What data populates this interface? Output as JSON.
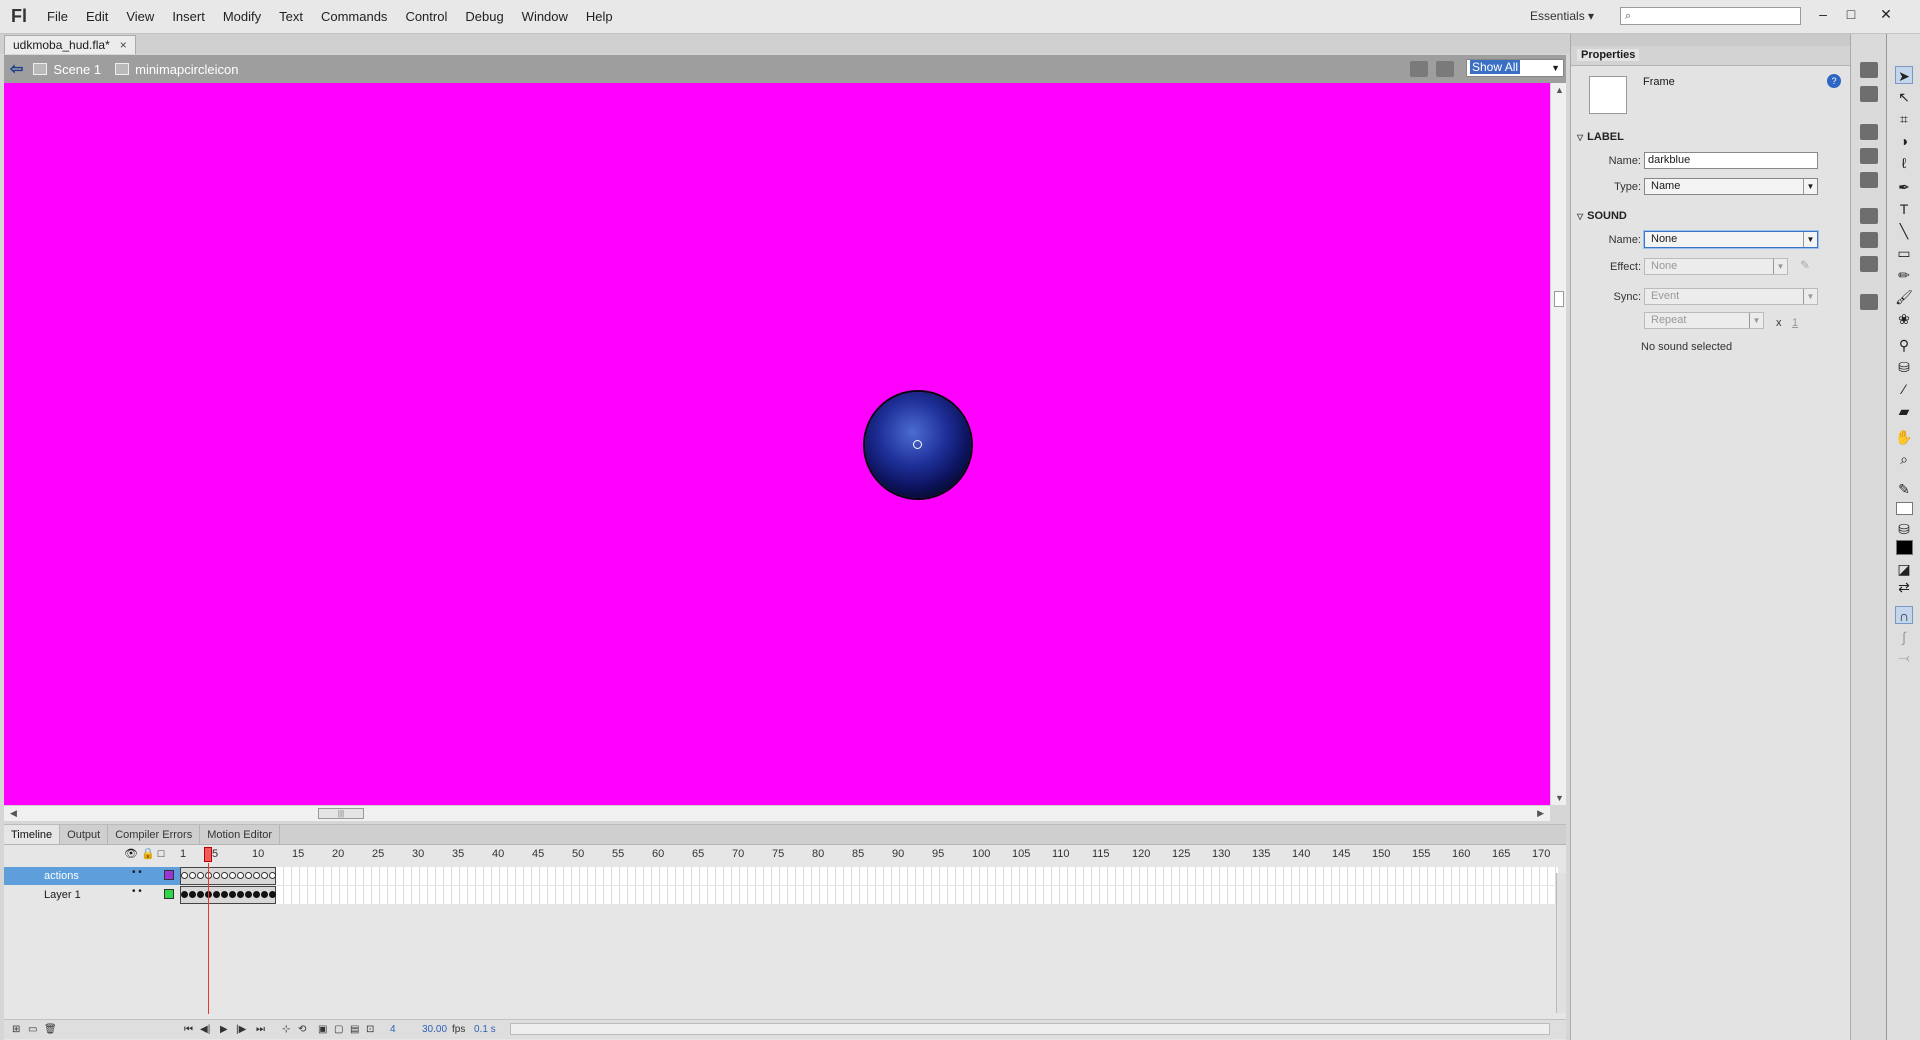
{
  "app": {
    "logo": "Fl",
    "menu": [
      "File",
      "Edit",
      "View",
      "Insert",
      "Modify",
      "Text",
      "Commands",
      "Control",
      "Debug",
      "Window",
      "Help"
    ],
    "workspace": "Essentials",
    "search_placeholder": "",
    "window_controls": [
      "–",
      "□",
      "✕"
    ]
  },
  "document": {
    "tab_title": "udkmoba_hud.fla*",
    "tab_close": "×",
    "breadcrumb": [
      "Scene 1",
      "minimapcircleicon"
    ],
    "zoom": "Show All"
  },
  "stage": {
    "background": "#ff00ff",
    "object": "dark blue circle icon"
  },
  "timeline": {
    "tabs": [
      "Timeline",
      "Output",
      "Compiler Errors",
      "Motion Editor"
    ],
    "active_tab": "Timeline",
    "ruler": [
      "1",
      "5",
      "10",
      "15",
      "20",
      "25",
      "30",
      "35",
      "40",
      "45",
      "50",
      "55",
      "60",
      "65",
      "70",
      "75",
      "80",
      "85",
      "90",
      "95",
      "100",
      "105",
      "110",
      "115",
      "120",
      "125",
      "130",
      "135",
      "140",
      "145",
      "150",
      "155",
      "160",
      "165",
      "170"
    ],
    "layers": [
      {
        "name": "actions",
        "selected": true,
        "color": "#9a36d8"
      },
      {
        "name": "Layer 1",
        "selected": false,
        "color": "#2fd64a"
      }
    ],
    "current_frame": "4",
    "fps": "30.00",
    "fps_unit": "fps",
    "elapsed": "0.1 s"
  },
  "properties": {
    "panel_title": "Properties",
    "type": "Frame",
    "label_section": "LABEL",
    "label_name_label": "Name:",
    "label_name_value": "darkblue",
    "label_type_label": "Type:",
    "label_type_value": "Name",
    "sound_section": "SOUND",
    "sound_name_label": "Name:",
    "sound_name_value": "None",
    "effect_label": "Effect:",
    "effect_value": "None",
    "sync_label": "Sync:",
    "sync_value": "Event",
    "repeat_value": "Repeat",
    "repeat_x": "x",
    "repeat_count": "1",
    "status": "No sound selected"
  }
}
